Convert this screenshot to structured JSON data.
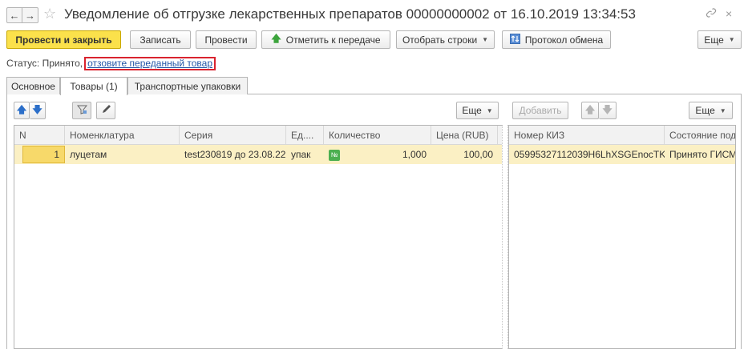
{
  "window": {
    "title": "Уведомление об отгрузке лекарственных препаратов 00000000002 от 16.10.2019 13:34:53",
    "nav_back": "←",
    "nav_forward": "→",
    "favorite_glyph": "☆",
    "link_glyph": "🔗",
    "close_glyph": "×"
  },
  "toolbar": {
    "post_and_close": "Провести и закрыть",
    "save": "Записать",
    "post": "Провести",
    "mark_for_transfer": "Отметить к передаче",
    "select_rows": "Отобрать строки",
    "exchange_log": "Протокол обмена",
    "more": "Еще"
  },
  "status": {
    "label": "Статус:",
    "value": "Принято,",
    "recall_link": "отзовите переданный товар"
  },
  "tabs": [
    {
      "label": "Основное",
      "active": false
    },
    {
      "label": "Товары (1)",
      "active": true
    },
    {
      "label": "Транспортные упаковки",
      "active": false
    }
  ],
  "left_table": {
    "more": "Еще",
    "columns": [
      "N",
      "Номенклатура",
      "Серия",
      "Ед....",
      "Количество",
      "Цена (RUB)"
    ],
    "rows": [
      {
        "n": "1",
        "nomenclature": "луцетам",
        "series": "test230819 до 23.08.22",
        "unit": "упак",
        "quantity_badge": "№",
        "quantity": "1,000",
        "price": "100,00"
      }
    ]
  },
  "right_table": {
    "add": "Добавить",
    "more": "Еще",
    "columns": [
      "Номер КИЗ",
      "Состояние под"
    ],
    "rows": [
      {
        "kiz": "05995327112039H6LhXSGEnocTK",
        "state": "Принято ГИСМ"
      }
    ]
  },
  "colors": {
    "primary_button": "#fbe14b",
    "selected_row": "#fbf0c4",
    "link": "#2457a8",
    "highlight_border": "#d9232e"
  }
}
